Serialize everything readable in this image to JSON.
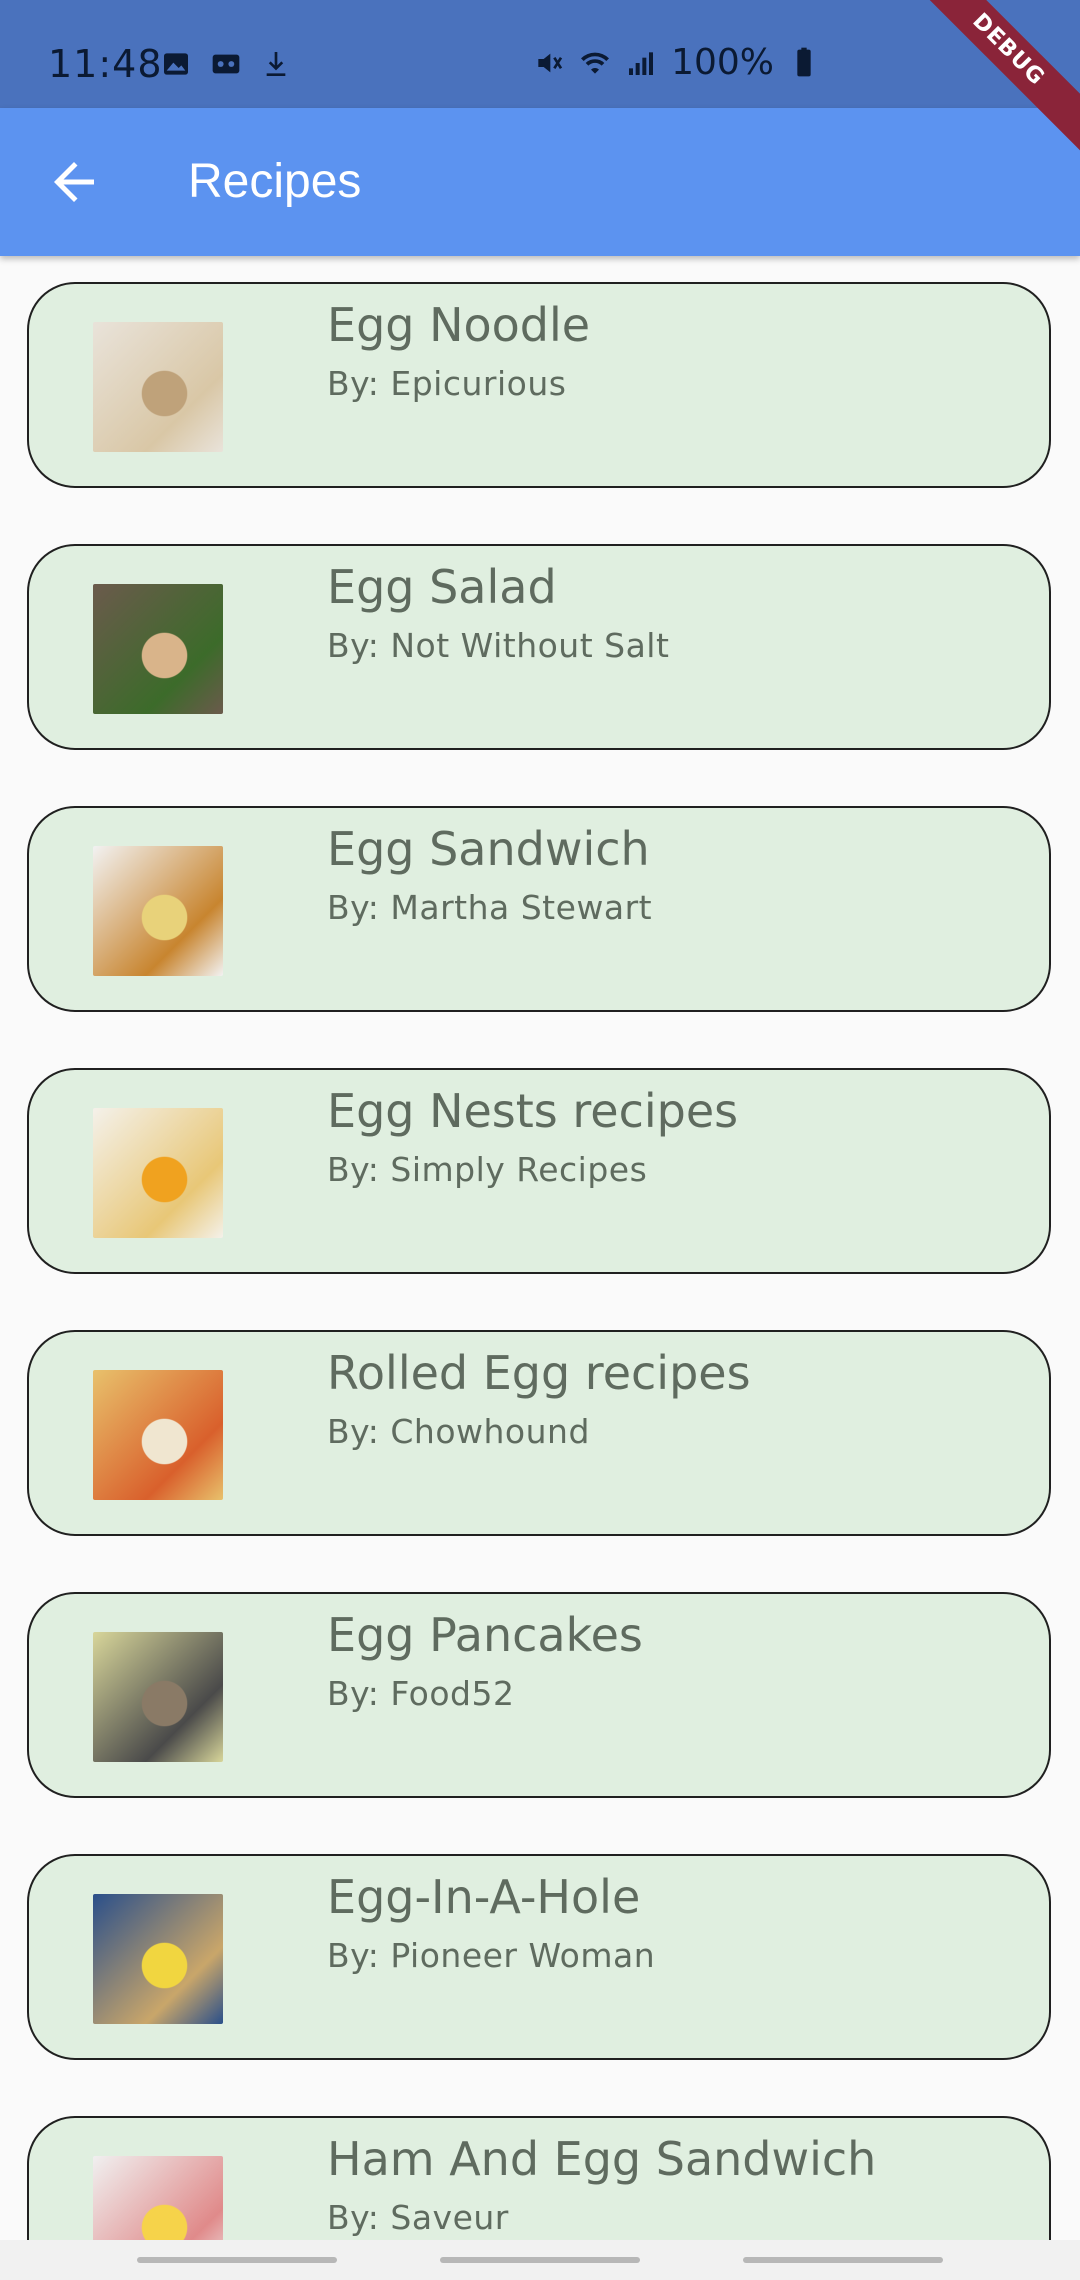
{
  "status_bar": {
    "time": "11:48",
    "battery": "100%",
    "icons": [
      "image-icon",
      "voicemail-icon",
      "download-icon",
      "mute-icon",
      "wifi-icon",
      "signal-icon",
      "battery-icon"
    ]
  },
  "app_bar": {
    "title": "Recipes",
    "back_icon": "arrow-back-icon"
  },
  "debug_banner": "DEBUG",
  "recipes": [
    {
      "title": "Egg Noodle",
      "author": "By: Epicurious",
      "thumb_colors": [
        "#e9e3da",
        "#d9c7a6",
        "#bfa27a"
      ]
    },
    {
      "title": "Egg Salad",
      "author": "By: Not Without Salt",
      "thumb_colors": [
        "#6b5a4c",
        "#3c6b2a",
        "#d9b48a"
      ]
    },
    {
      "title": "Egg Sandwich",
      "author": "By: Martha Stewart",
      "thumb_colors": [
        "#f2f2f2",
        "#c8852f",
        "#e8d27a"
      ]
    },
    {
      "title": "Egg Nests recipes",
      "author": "By: Simply Recipes",
      "thumb_colors": [
        "#f4f1ea",
        "#e8c777",
        "#f0a21f"
      ]
    },
    {
      "title": "Rolled Egg recipes",
      "author": "By: Chowhound",
      "thumb_colors": [
        "#e8c16c",
        "#d9602c",
        "#f0e6d0"
      ]
    },
    {
      "title": "Egg Pancakes",
      "author": "By: Food52",
      "thumb_colors": [
        "#d8d69a",
        "#4a4a4a",
        "#8a7a66"
      ]
    },
    {
      "title": "Egg-In-A-Hole",
      "author": "By: Pioneer Woman",
      "thumb_colors": [
        "#2a4f8a",
        "#c9a66a",
        "#f1d640"
      ]
    },
    {
      "title": "Ham And Egg Sandwich",
      "author": "By: Saveur",
      "thumb_colors": [
        "#f0f0f0",
        "#e08a8a",
        "#f6d34a"
      ]
    }
  ]
}
